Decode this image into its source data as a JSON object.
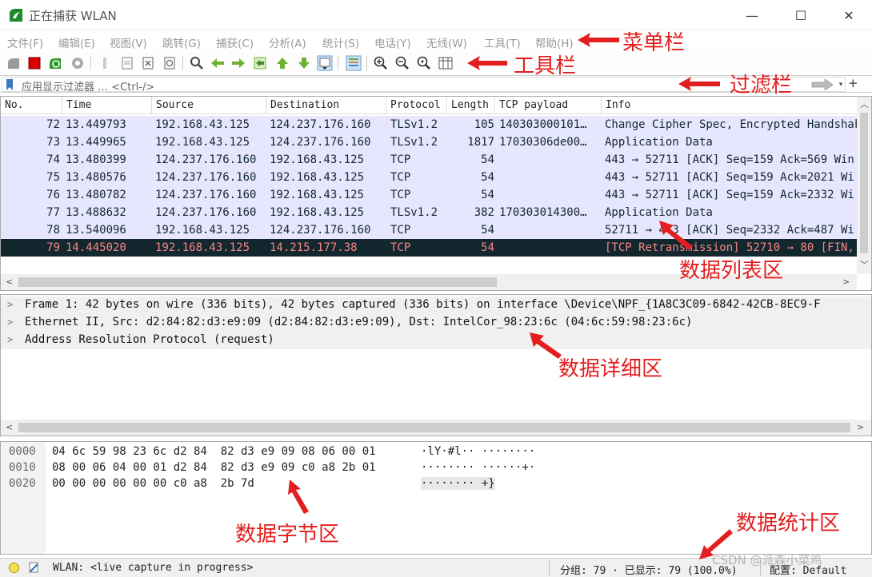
{
  "window": {
    "title": "正在捕获 WLAN",
    "min_glyph": "—",
    "max_glyph": "☐",
    "close_glyph": "✕"
  },
  "menu": [
    "文件(F)",
    "编辑(E)",
    "视图(V)",
    "跳转(G)",
    "捕获(C)",
    "分析(A)",
    "统计(S)",
    "电话(Y)",
    "无线(W)",
    "工具(T)",
    "帮助(H)"
  ],
  "filter": {
    "placeholder": "应用显示过滤器 … <Ctrl-/>",
    "dropdown_glyph": "▾",
    "add_glyph": "+"
  },
  "packet_list": {
    "columns": [
      "No.",
      "Time",
      "Source",
      "Destination",
      "Protocol",
      "Length",
      "TCP payload",
      "Info"
    ],
    "rows": [
      {
        "no": "72",
        "time": "13.449793",
        "src": "192.168.43.125",
        "dst": "124.237.176.160",
        "proto": "TLSv1.2",
        "len": "105",
        "payload": "140303000101…",
        "info": "Change Cipher Spec, Encrypted Handshake Message",
        "selected": false
      },
      {
        "no": "73",
        "time": "13.449965",
        "src": "192.168.43.125",
        "dst": "124.237.176.160",
        "proto": "TLSv1.2",
        "len": "1817",
        "payload": "17030306de00…",
        "info": "Application Data",
        "selected": false
      },
      {
        "no": "74",
        "time": "13.480399",
        "src": "124.237.176.160",
        "dst": "192.168.43.125",
        "proto": "TCP",
        "len": "54",
        "payload": "",
        "info": "443 → 52711 [ACK] Seq=159 Ack=569 Win",
        "selected": false
      },
      {
        "no": "75",
        "time": "13.480576",
        "src": "124.237.176.160",
        "dst": "192.168.43.125",
        "proto": "TCP",
        "len": "54",
        "payload": "",
        "info": "443 → 52711 [ACK] Seq=159 Ack=2021 Wi",
        "selected": false
      },
      {
        "no": "76",
        "time": "13.480782",
        "src": "124.237.176.160",
        "dst": "192.168.43.125",
        "proto": "TCP",
        "len": "54",
        "payload": "",
        "info": "443 → 52711 [ACK] Seq=159 Ack=2332 Wi",
        "selected": false
      },
      {
        "no": "77",
        "time": "13.488632",
        "src": "124.237.176.160",
        "dst": "192.168.43.125",
        "proto": "TLSv1.2",
        "len": "382",
        "payload": "170303014300…",
        "info": "Application Data",
        "selected": false
      },
      {
        "no": "78",
        "time": "13.540096",
        "src": "192.168.43.125",
        "dst": "124.237.176.160",
        "proto": "TCP",
        "len": "54",
        "payload": "",
        "info": "52711 → 443 [ACK] Seq=2332 Ack=487 Wi",
        "selected": false
      },
      {
        "no": "79",
        "time": "14.445020",
        "src": "192.168.43.125",
        "dst": "14.215.177.38",
        "proto": "TCP",
        "len": "54",
        "payload": "",
        "info": "[TCP Retransmission] 52710 → 80 [FIN,",
        "selected": true
      }
    ]
  },
  "details": [
    "Frame 1: 42 bytes on wire (336 bits), 42 bytes captured (336 bits) on interface \\Device\\NPF_{1A8C3C09-6842-42CB-8EC9-F",
    "Ethernet II, Src: d2:84:82:d3:e9:09 (d2:84:82:d3:e9:09), Dst: IntelCor_98:23:6c (04:6c:59:98:23:6c)",
    "Address Resolution Protocol (request)"
  ],
  "bytes": [
    {
      "offset": "0000",
      "hex": "04 6c 59 98 23 6c d2 84  82 d3 e9 09 08 06 00 01",
      "ascii": "·lY·#l·· ········"
    },
    {
      "offset": "0010",
      "hex": "08 00 06 04 00 01 d2 84  82 d3 e9 09 c0 a8 2b 01",
      "ascii": "········ ······+·"
    },
    {
      "offset": "0020",
      "hex": "00 00 00 00 00 00 c0 a8  2b 7d",
      "ascii": "········ +}"
    }
  ],
  "status": {
    "interface_text": "WLAN: <live capture in progress>",
    "packets_text": "分组: 79 · 已显示: 79 (100.0%)",
    "profile_text": "配置: Default"
  },
  "annotations": {
    "menubar": "菜单栏",
    "toolbar": "工具栏",
    "filterbar": "过滤栏",
    "packet_list": "数据列表区",
    "details": "数据详细区",
    "bytes": "数据字节区",
    "stats": "数据统计区"
  },
  "watermark": "CSDN @派森小菜鸡",
  "colors": {
    "row_bg": "#e7e6ff",
    "row_text": "#12272e",
    "selected_bg": "#12272e",
    "selected_text": "#f78787",
    "annotation": "#e41e1e",
    "logo_green": "#1a8a2a"
  }
}
